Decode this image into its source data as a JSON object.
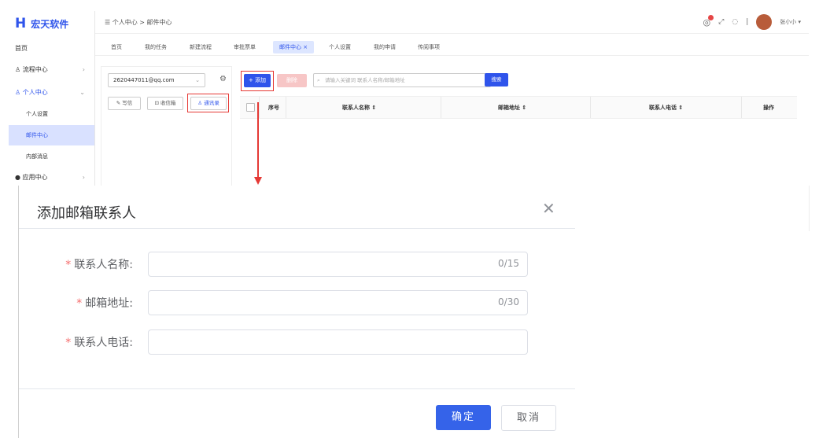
{
  "app": {
    "logo_mark": "H",
    "logo_text": "宏天软件",
    "breadcrumb": "☰  个人中心  >  邮件中心",
    "user_name": "张小小 ▾"
  },
  "sidebar": {
    "items": [
      {
        "label": "首页"
      },
      {
        "label": "♙ 流程中心",
        "chev": "›"
      },
      {
        "label": "♙ 个人中心",
        "chev": "⌄"
      },
      {
        "label": "个人设置"
      },
      {
        "label": "邮件中心"
      },
      {
        "label": "内部消息"
      },
      {
        "label": "● 应用中心",
        "chev": "›"
      }
    ]
  },
  "tabs": [
    "首页",
    "我的任务",
    "新建流程",
    "审批票单",
    "邮件中心 ×",
    "个人设置",
    "我的申请",
    "传阅事项"
  ],
  "left_panel": {
    "account": "2620447011@qq.com",
    "btn_write": "✎ 写信",
    "btn_inbox": "⊡ 收信箱",
    "btn_contacts": "♙ 通讯录"
  },
  "main_panel": {
    "add_label": "+ 添加",
    "delete_label": "删除",
    "search_placeholder": "请输入关键词 联系人名称/邮箱地址",
    "search_label": "搜索",
    "columns": [
      "序号",
      "联系人名称 ⇕",
      "邮箱地址 ⇕",
      "联系人电话 ⇕",
      "操作"
    ]
  },
  "dialog": {
    "title": "添加邮箱联系人",
    "fields": [
      {
        "label": "联系人名称:",
        "counter": "0/15"
      },
      {
        "label": "邮箱地址:",
        "counter": "0/30"
      },
      {
        "label": "联系人电话:",
        "counter": ""
      }
    ],
    "required_mark": "*",
    "ok_label": "确定",
    "cancel_label": "取消"
  },
  "colors": {
    "accent": "#2f54eb",
    "annotation": "#e53935",
    "required": "#f56c6c"
  },
  "icons": [
    "close-icon",
    "bell-icon",
    "fullscreen-icon",
    "settings-icon",
    "search-icon",
    "gear-icon"
  ]
}
